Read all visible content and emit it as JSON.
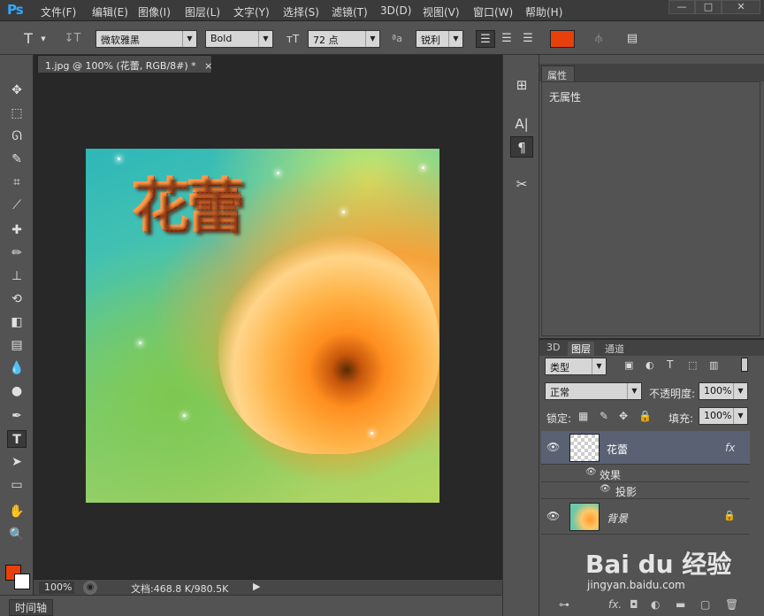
{
  "app": {
    "logo": "Ps"
  },
  "menu": [
    "文件(F)",
    "编辑(E)",
    "图像(I)",
    "图层(L)",
    "文字(Y)",
    "选择(S)",
    "滤镜(T)",
    "3D(D)",
    "视图(V)",
    "窗口(W)",
    "帮助(H)"
  ],
  "window_buttons": {
    "minimize": "—",
    "restore": "□",
    "close": "✕"
  },
  "options": {
    "tool_icon": "T",
    "font_family": "微软雅黑",
    "font_style": "Bold",
    "font_size": "72 点",
    "aa_label": "ªa",
    "antialias": "锐利",
    "text_color": "#e8400c"
  },
  "document": {
    "tab_title": "1.jpg @ 100% (花蕾, RGB/8#) *",
    "tab_close": "×",
    "canvas_text": "花蕾",
    "zoom": "100%",
    "doc_info": "文档:468.8 K/980.5K"
  },
  "timeline": {
    "label": "时间轴"
  },
  "properties": {
    "tab": "属性",
    "content": "无属性"
  },
  "layers": {
    "tabs": [
      "3D",
      "图层",
      "通道"
    ],
    "filter_kind": "类型",
    "blend_mode": "正常",
    "opacity_label": "不透明度:",
    "opacity": "100%",
    "lock_label": "锁定:",
    "fill_label": "填充:",
    "fill": "100%",
    "items": [
      {
        "name": "花蕾",
        "fx": "fx",
        "selected": true
      },
      {
        "name": "背景",
        "selected": false
      }
    ],
    "effects_label": "效果",
    "effect_item": "投影"
  },
  "watermark": {
    "brand": "Bai du 经验",
    "url": "jingyan.baidu.com"
  }
}
